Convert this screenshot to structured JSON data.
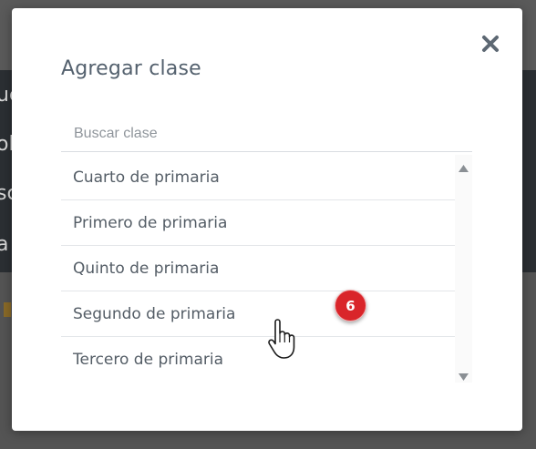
{
  "backdrop": {
    "fragments": [
      "uc",
      "ol",
      "sc",
      "a"
    ]
  },
  "modal": {
    "title": "Agregar clase",
    "close_icon": "close-icon",
    "search": {
      "placeholder": "Buscar clase",
      "value": ""
    },
    "classes": [
      {
        "label": "Cuarto de primaria"
      },
      {
        "label": "Primero de primaria"
      },
      {
        "label": "Quinto de primaria"
      },
      {
        "label": "Segundo de primaria"
      },
      {
        "label": "Tercero de primaria"
      }
    ]
  },
  "overlay": {
    "step_number": "6",
    "cursor_icon": "hand-pointer-icon"
  },
  "colors": {
    "title": "#54616e",
    "item_text": "#545d66",
    "badge": "#d9252a",
    "close_icon": "#5d6873"
  }
}
